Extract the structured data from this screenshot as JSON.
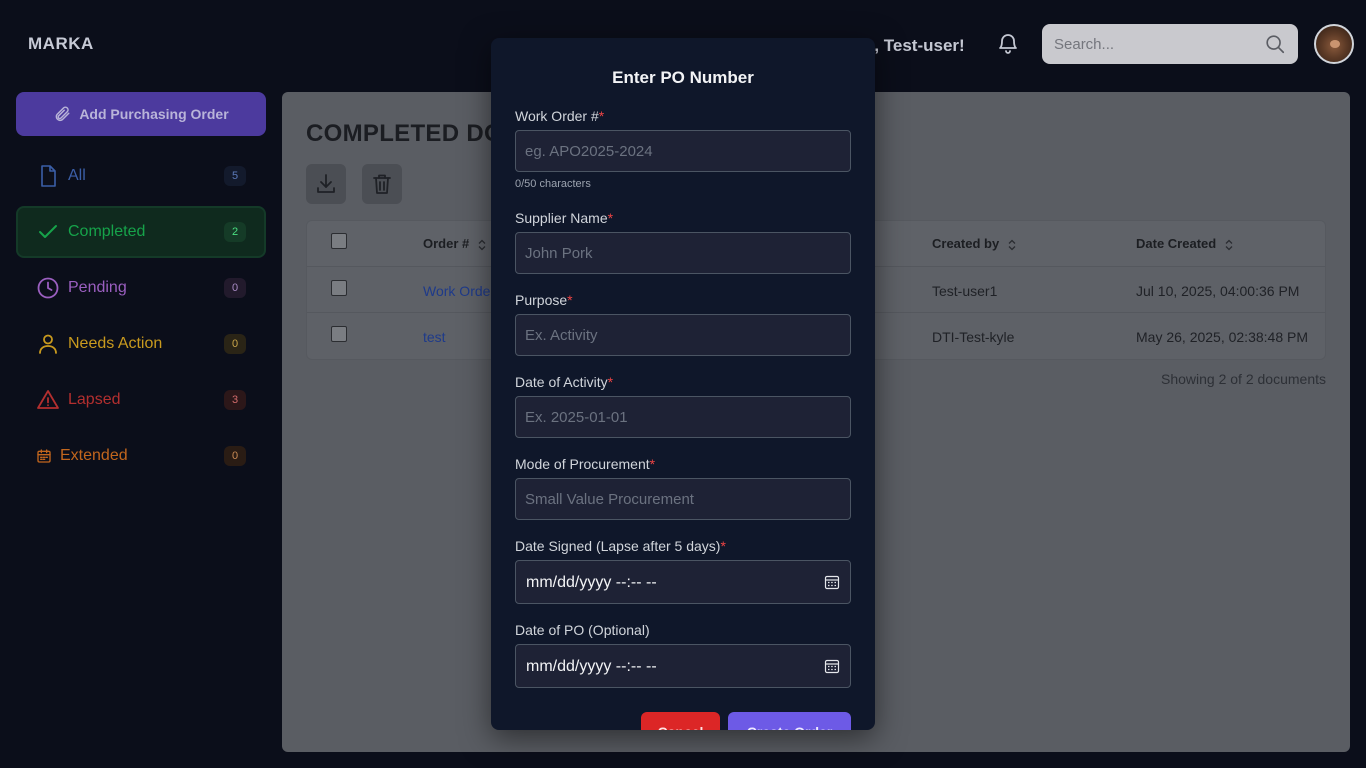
{
  "app": {
    "brand": "MARKA",
    "welcome": "Welcome, Test-user!",
    "search_placeholder": "Search..."
  },
  "sidebar": {
    "add_button": "Add Purchasing Order",
    "items": [
      {
        "label": "All",
        "count": "5",
        "color": "#3b5fa8",
        "icon": "file-icon"
      },
      {
        "label": "Completed",
        "count": "2",
        "color": "#16a34a",
        "icon": "check-icon",
        "active": true
      },
      {
        "label": "Pending",
        "count": "0",
        "color": "#9b5fc0",
        "icon": "clock-icon"
      },
      {
        "label": "Needs Action",
        "count": "0",
        "color": "#c99a1e",
        "icon": "user-icon"
      },
      {
        "label": "Lapsed",
        "count": "3",
        "color": "#b32f2f",
        "icon": "warning-icon"
      },
      {
        "label": "Extended",
        "count": "0",
        "color": "#c2661d",
        "icon": "calendar-icon"
      }
    ]
  },
  "main": {
    "title": "COMPLETED DOCUMENTS",
    "table": {
      "columns": [
        "Order #",
        "Created by",
        "Date Created"
      ],
      "rows": [
        {
          "order": "Work Order",
          "created_by": "Test-user1",
          "date_created": "Jul 10, 2025, 04:00:36 PM"
        },
        {
          "order": "test",
          "created_by": "DTI-Test-kyle",
          "date_created": "May 26, 2025, 02:38:48 PM"
        }
      ]
    },
    "showing": "Showing 2 of 2 documents"
  },
  "modal": {
    "title": "Enter PO Number",
    "fields": {
      "work_order": {
        "label": "Work Order #",
        "placeholder": "eg. APO2025-2024",
        "counter": "0/50 characters"
      },
      "supplier": {
        "label": "Supplier Name",
        "placeholder": "John Pork"
      },
      "purpose": {
        "label": "Purpose",
        "placeholder": "Ex. Activity"
      },
      "date_activity": {
        "label": "Date of Activity",
        "placeholder": "Ex. 2025-01-01"
      },
      "mode": {
        "label": "Mode of Procurement",
        "placeholder": "Small Value Procurement"
      },
      "date_signed": {
        "label": "Date Signed (Lapse after 5 days)",
        "value": "mm/dd/yyyy --:-- --"
      },
      "date_po": {
        "label": "Date of PO (Optional)",
        "value": "mm/dd/yyyy --:-- --"
      }
    },
    "required_mark": "*",
    "cancel": "Cancel",
    "create": "Create Order"
  }
}
